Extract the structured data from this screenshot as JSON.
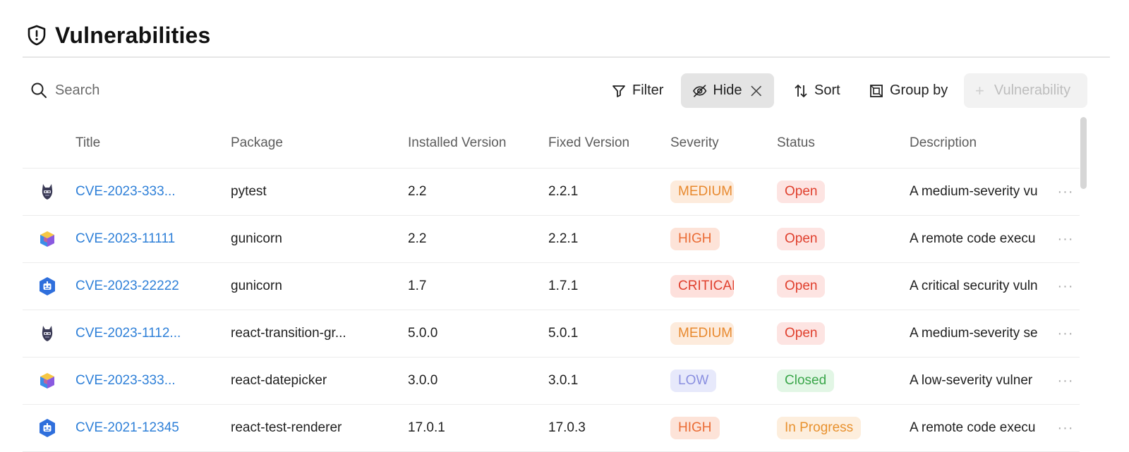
{
  "header": {
    "title": "Vulnerabilities",
    "icon": "shield-icon"
  },
  "toolbar": {
    "search_placeholder": "Search",
    "filter_label": "Filter",
    "hide_label": "Hide",
    "sort_label": "Sort",
    "group_label": "Group by",
    "add_label": "Vulnerability"
  },
  "columns": {
    "title": "Title",
    "package": "Package",
    "installed": "Installed Version",
    "fixed": "Fixed Version",
    "severity": "Severity",
    "status": "Status",
    "description": "Description"
  },
  "rows": [
    {
      "icon": "ninja-mascot-icon",
      "title": "CVE-2023-333...",
      "package": "pytest",
      "installed": "2.2",
      "fixed": "2.2.1",
      "severity": "MEDIUM",
      "status": "Open",
      "description": "A medium-severity vu"
    },
    {
      "icon": "cube-icon",
      "title": "CVE-2023-11111",
      "package": "gunicorn",
      "installed": "2.2",
      "fixed": "2.2.1",
      "severity": "HIGH",
      "status": "Open",
      "description": "A remote code execu"
    },
    {
      "icon": "robot-hexagon-icon",
      "title": "CVE-2023-22222",
      "package": "gunicorn",
      "installed": "1.7",
      "fixed": "1.7.1",
      "severity": "CRITICAL",
      "status": "Open",
      "description": "A critical security vuln"
    },
    {
      "icon": "ninja-mascot-icon",
      "title": "CVE-2023-1112...",
      "package": "react-transition-gr...",
      "installed": "5.0.0",
      "fixed": "5.0.1",
      "severity": "MEDIUM",
      "status": "Open",
      "description": "A medium-severity se"
    },
    {
      "icon": "cube-icon",
      "title": "CVE-2023-333...",
      "package": "react-datepicker",
      "installed": "3.0.0",
      "fixed": "3.0.1",
      "severity": "LOW",
      "status": "Closed",
      "description": "A low-severity vulner"
    },
    {
      "icon": "robot-hexagon-icon",
      "title": "CVE-2021-12345",
      "package": "react-test-renderer",
      "installed": "17.0.1",
      "fixed": "17.0.3",
      "severity": "HIGH",
      "status": "In Progress",
      "description": "A remote code execu"
    }
  ],
  "colors": {
    "link": "#2f80d8",
    "hide_bg": "#e4e4e4",
    "medium": "#e8892e",
    "high": "#ea6c35",
    "critical": "#e0402e",
    "low": "#8a8fe0",
    "closed": "#3aa64a"
  }
}
